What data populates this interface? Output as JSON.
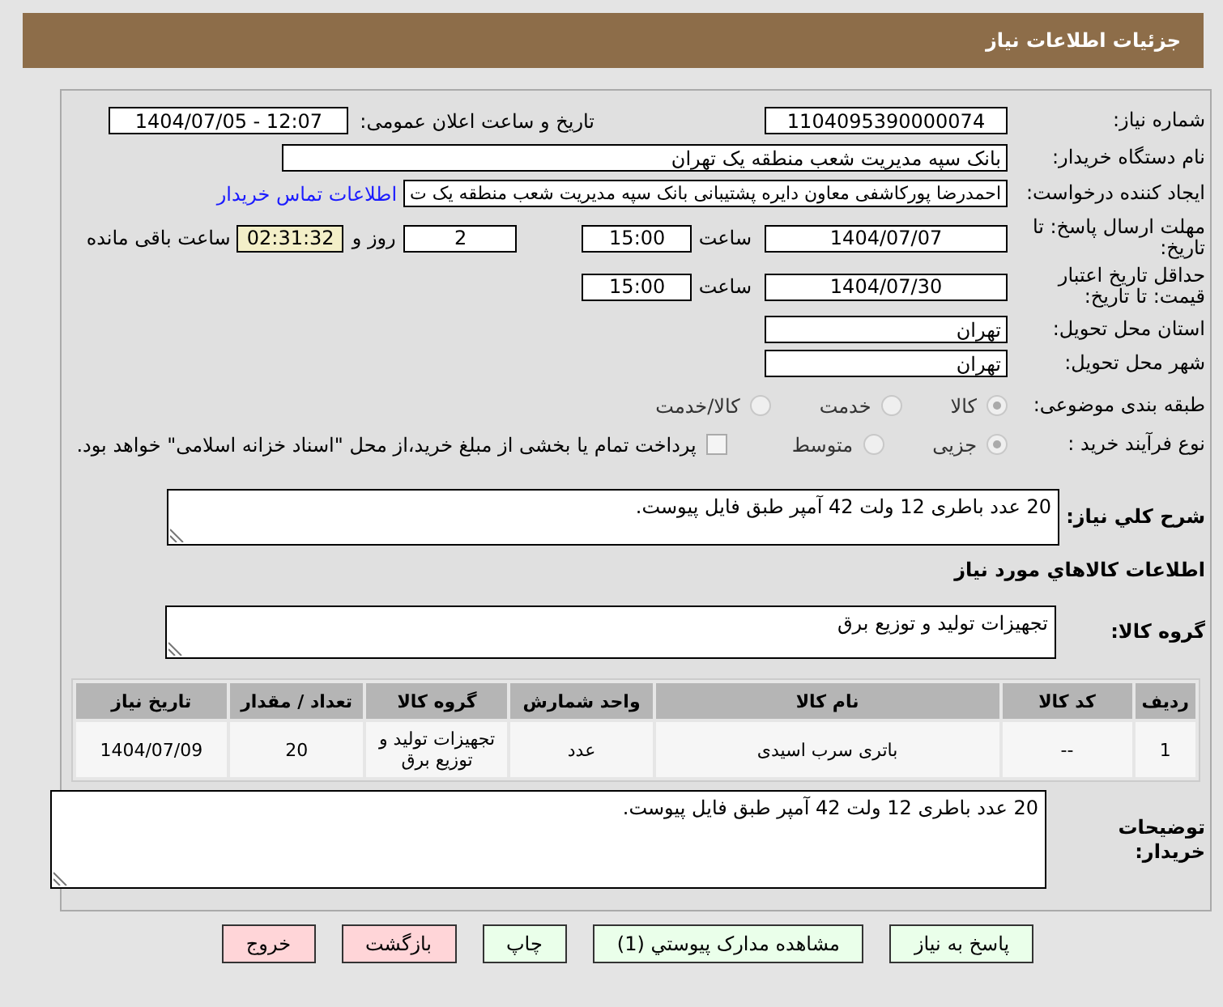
{
  "header": {
    "title": "جزئیات اطلاعات نیاز"
  },
  "need_number": {
    "label": "شماره نیاز:",
    "value": "1104095390000074"
  },
  "announce": {
    "label": "تاریخ و ساعت اعلان عمومی:",
    "value": "1404/07/05 - 12:07"
  },
  "buyer_org": {
    "label": "نام دستگاه خریدار:",
    "value": "بانک سپه مدیریت شعب منطقه یک تهران"
  },
  "requester": {
    "label": "ایجاد کننده درخواست:",
    "value": "احمدرضا پورکاشفی معاون دایره پشتیبانی بانک سپه مدیریت شعب منطقه یک ت",
    "contact_link": "اطلاعات تماس خریدار"
  },
  "deadline": {
    "label": "مهلت ارسال پاسخ: تا تاریخ:",
    "date": "1404/07/07",
    "time_label": "ساعت",
    "time": "15:00",
    "days": "2",
    "days_label": "روز و",
    "remaining": "02:31:32",
    "remaining_label": "ساعت باقی مانده"
  },
  "validity": {
    "label": "حداقل تاریخ اعتبار قیمت: تا تاریخ:",
    "date": "1404/07/30",
    "time_label": "ساعت",
    "time": "15:00"
  },
  "province": {
    "label": "استان محل تحویل:",
    "value": "تهران"
  },
  "city": {
    "label": "شهر محل تحویل:",
    "value": "تهران"
  },
  "category": {
    "label": "طبقه بندی موضوعی:",
    "options": [
      {
        "label": "کالا",
        "selected": true,
        "disabled": true
      },
      {
        "label": "خدمت",
        "selected": false,
        "disabled": true
      },
      {
        "label": "کالا/خدمت",
        "selected": false,
        "disabled": true
      }
    ]
  },
  "purchase_type": {
    "label": "نوع فرآیند خرید :",
    "options": [
      {
        "label": "جزیی",
        "selected": true,
        "disabled": true
      },
      {
        "label": "متوسط",
        "selected": false,
        "disabled": true
      }
    ],
    "treasury": {
      "label": "پرداخت تمام یا بخشی از مبلغ خرید،از محل \"اسناد خزانه اسلامی\" خواهد بود.",
      "checked": false
    }
  },
  "description": {
    "label": "شرح کلي نياز:",
    "value": "20 عدد باطری 12 ولت 42 آمپر طبق فایل پیوست."
  },
  "items_heading": "اطلاعات کالاهاي مورد نياز",
  "goods_group": {
    "label": "گروه کالا:",
    "value": "تجهیزات تولید و توزیع برق"
  },
  "table": {
    "columns": [
      "ردیف",
      "کد کالا",
      "نام کالا",
      "واحد شمارش",
      "گروه کالا",
      "تعداد / مقدار",
      "تاریخ نیاز"
    ],
    "rows": [
      [
        "1",
        "--",
        "باتری سرب اسیدی",
        "عدد",
        "تجهیزات تولید و توزیع برق",
        "20",
        "1404/07/09"
      ]
    ]
  },
  "buyer_notes": {
    "label": "توضیحات خریدار:",
    "value": "20 عدد باطری 12 ولت 42 آمپر طبق فایل پیوست."
  },
  "buttons": [
    {
      "label": "پاسخ به نیاز",
      "kind": "normal"
    },
    {
      "label": "مشاهده مدارک پیوستي (1)",
      "kind": "normal"
    },
    {
      "label": "چاپ",
      "kind": "normal"
    },
    {
      "label": "بازگشت",
      "kind": "danger"
    },
    {
      "label": "خروج",
      "kind": "danger"
    }
  ]
}
